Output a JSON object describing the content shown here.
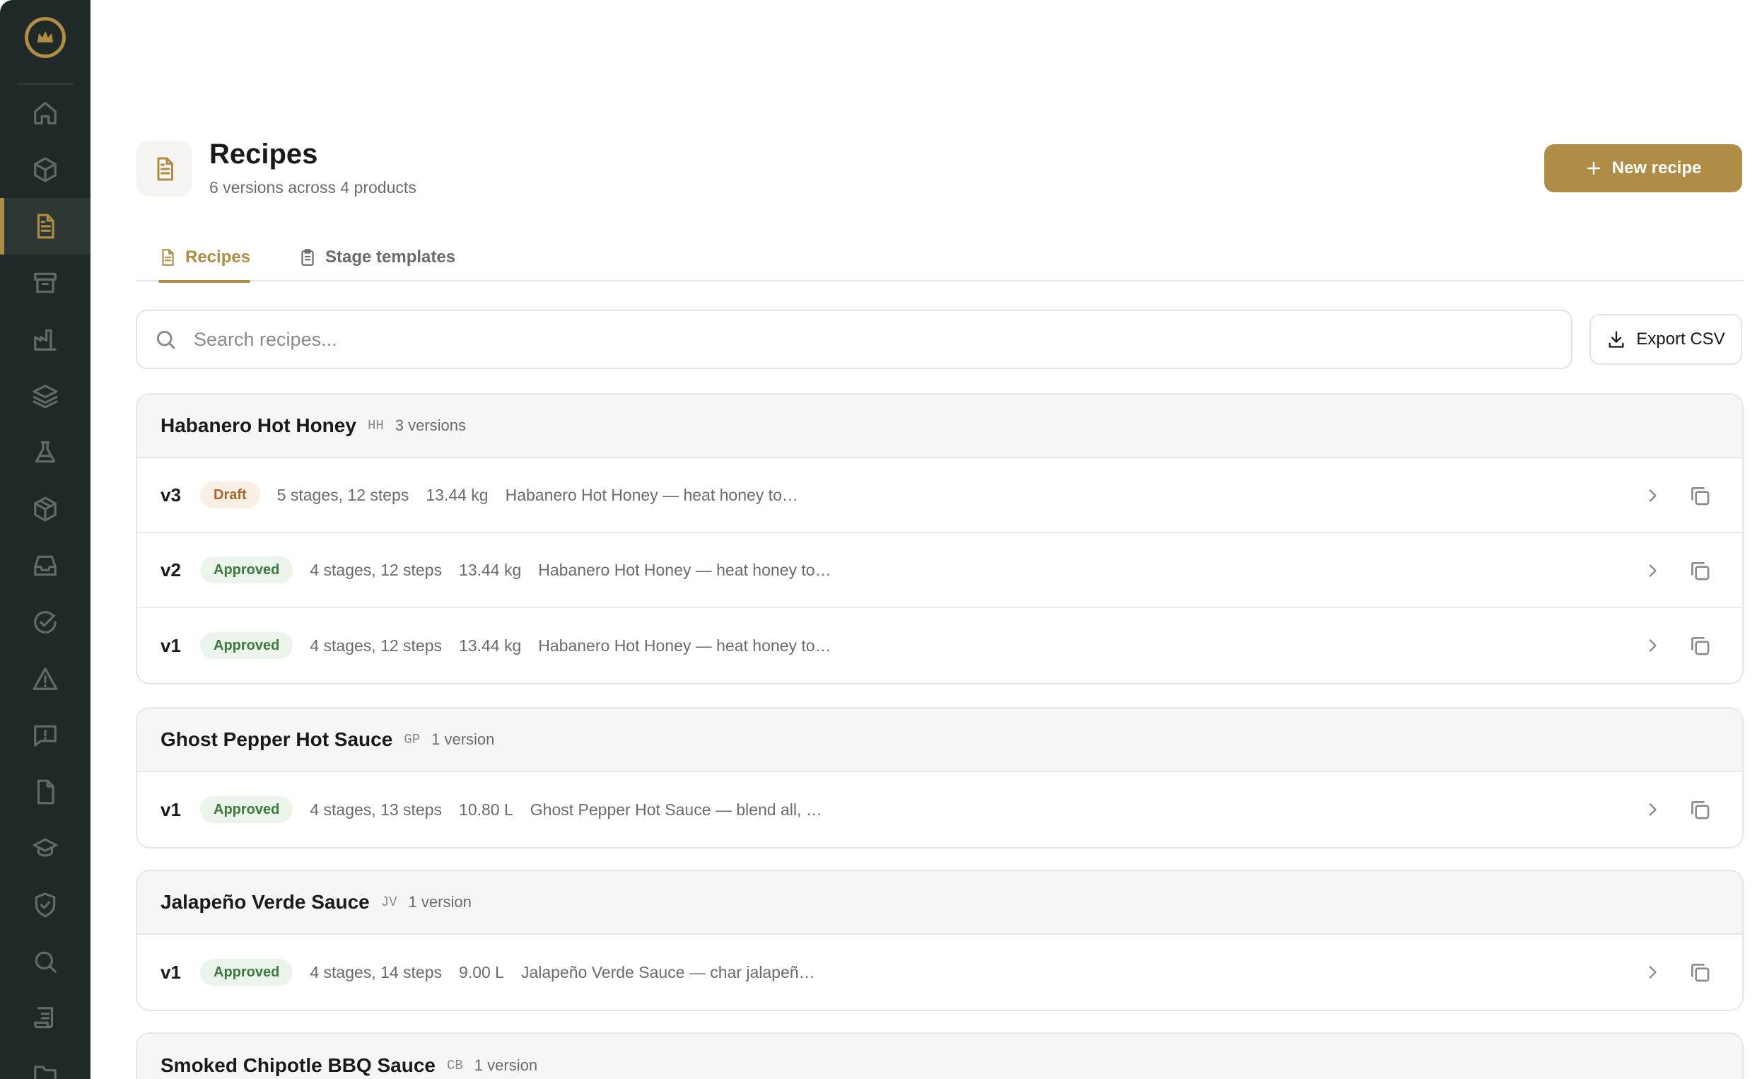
{
  "sidebar": {
    "logo": "crown-logo-icon",
    "items": [
      {
        "icon": "home-icon",
        "active": false
      },
      {
        "icon": "box-icon",
        "active": false
      },
      {
        "icon": "document-icon",
        "active": true
      },
      {
        "icon": "archive-icon",
        "active": false
      },
      {
        "icon": "factory-icon",
        "active": false
      },
      {
        "icon": "layers-icon",
        "active": false
      },
      {
        "icon": "flask-icon",
        "active": false
      },
      {
        "icon": "package-icon",
        "active": false
      },
      {
        "icon": "inbox-icon",
        "active": false
      },
      {
        "icon": "check-circle-icon",
        "active": false
      },
      {
        "icon": "warning-icon",
        "active": false
      },
      {
        "icon": "message-alert-icon",
        "active": false
      },
      {
        "icon": "file-icon",
        "active": false
      },
      {
        "icon": "graduation-cap-icon",
        "active": false
      },
      {
        "icon": "shield-check-icon",
        "active": false
      },
      {
        "icon": "search-icon",
        "active": false
      },
      {
        "icon": "scroll-icon",
        "active": false
      },
      {
        "icon": "folder-icon",
        "active": false
      }
    ]
  },
  "header": {
    "title": "Recipes",
    "subtitle": "6 versions across 4 products",
    "new_button_label": "New recipe"
  },
  "tabs": [
    {
      "label": "Recipes",
      "icon": "document-icon",
      "active": true
    },
    {
      "label": "Stage templates",
      "icon": "clipboard-icon",
      "active": false
    }
  ],
  "search": {
    "placeholder": "Search recipes...",
    "value": ""
  },
  "export_label": "Export CSV",
  "groups": [
    {
      "name": "Habanero Hot Honey",
      "code": "HH",
      "count": "3 versions",
      "rows": [
        {
          "version": "v3",
          "status": "Draft",
          "status_type": "draft",
          "stages": "5 stages, 12 steps",
          "yield": "13.44 kg",
          "description": "Habanero Hot Honey — heat honey to…"
        },
        {
          "version": "v2",
          "status": "Approved",
          "status_type": "approved",
          "stages": "4 stages, 12 steps",
          "yield": "13.44 kg",
          "description": "Habanero Hot Honey — heat honey to…"
        },
        {
          "version": "v1",
          "status": "Approved",
          "status_type": "approved",
          "stages": "4 stages, 12 steps",
          "yield": "13.44 kg",
          "description": "Habanero Hot Honey — heat honey to…"
        }
      ]
    },
    {
      "name": "Ghost Pepper Hot Sauce",
      "code": "GP",
      "count": "1 version",
      "rows": [
        {
          "version": "v1",
          "status": "Approved",
          "status_type": "approved",
          "stages": "4 stages, 13 steps",
          "yield": "10.80 L",
          "description": "Ghost Pepper Hot Sauce — blend all, …"
        }
      ]
    },
    {
      "name": "Jalapeño Verde Sauce",
      "code": "JV",
      "count": "1 version",
      "rows": [
        {
          "version": "v1",
          "status": "Approved",
          "status_type": "approved",
          "stages": "4 stages, 14 steps",
          "yield": "9.00 L",
          "description": "Jalapeño Verde Sauce — char jalapeñ…"
        }
      ]
    },
    {
      "name": "Smoked Chipotle BBQ Sauce",
      "code": "CB",
      "count": "1 version",
      "rows": []
    }
  ],
  "colors": {
    "accent": "#b08d47",
    "sidebar_bg": "#1f2a28",
    "draft_text": "#a7672a",
    "approved_text": "#3e7a3f"
  }
}
